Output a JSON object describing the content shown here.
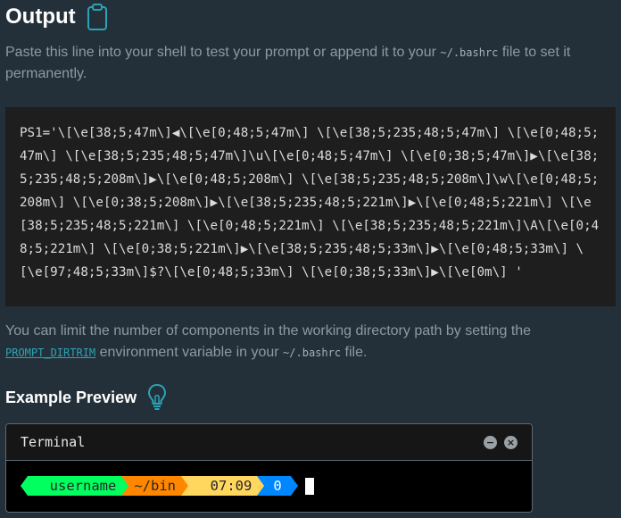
{
  "header": {
    "title": "Output",
    "icon": "clipboard-icon"
  },
  "intro": {
    "text_before": "Paste this line into your shell to test your prompt or append it to your ",
    "path": "~/.bashrc",
    "text_after": " file to set it permanently."
  },
  "code": {
    "ps1": "PS1='\\[\\e[38;5;47m\\]◀\\[\\e[0;48;5;47m\\] \\[\\e[38;5;235;48;5;47m\\] \\[\\e[0;48;5;47m\\] \\[\\e[38;5;235;48;5;47m\\]\\u\\[\\e[0;48;5;47m\\] \\[\\e[0;38;5;47m\\]▶\\[\\e[38;5;235;48;5;208m\\]▶\\[\\e[0;48;5;208m\\] \\[\\e[38;5;235;48;5;208m\\]\\w\\[\\e[0;48;5;208m\\] \\[\\e[0;38;5;208m\\]▶\\[\\e[38;5;235;48;5;221m\\]▶\\[\\e[0;48;5;221m\\] \\[\\e[38;5;235;48;5;221m\\] \\[\\e[0;48;5;221m\\] \\[\\e[38;5;235;48;5;221m\\]\\A\\[\\e[0;48;5;221m\\] \\[\\e[0;38;5;221m\\]▶\\[\\e[38;5;235;48;5;33m\\]▶\\[\\e[0;48;5;33m\\] \\[\\e[97;48;5;33m\\]$?\\[\\e[0;48;5;33m\\] \\[\\e[0;38;5;33m\\]▶\\[\\e[0m\\] '"
  },
  "dirtrim": {
    "text_before": "You can limit the number of components in the working directory path by setting the ",
    "var": "PROMPT_DIRTRIM",
    "text_middle": " environment variable in your ",
    "path": "~/.bashrc",
    "text_after": " file."
  },
  "preview": {
    "title": "Example Preview",
    "icon": "lightbulb-icon",
    "terminal": {
      "title": "Terminal",
      "minimize_label": "−",
      "close_label": "×",
      "segments": {
        "user_icon": "",
        "username": "username",
        "dir": "~/bin",
        "time_icon": "",
        "time": "07:09",
        "status": "0"
      }
    }
  },
  "colors": {
    "background": "#243039",
    "seg_green": "#00ff5f",
    "seg_orange": "#ff8700",
    "seg_yellow": "#ffd75f",
    "seg_blue": "#0087ff",
    "seg_text": "#262626"
  }
}
